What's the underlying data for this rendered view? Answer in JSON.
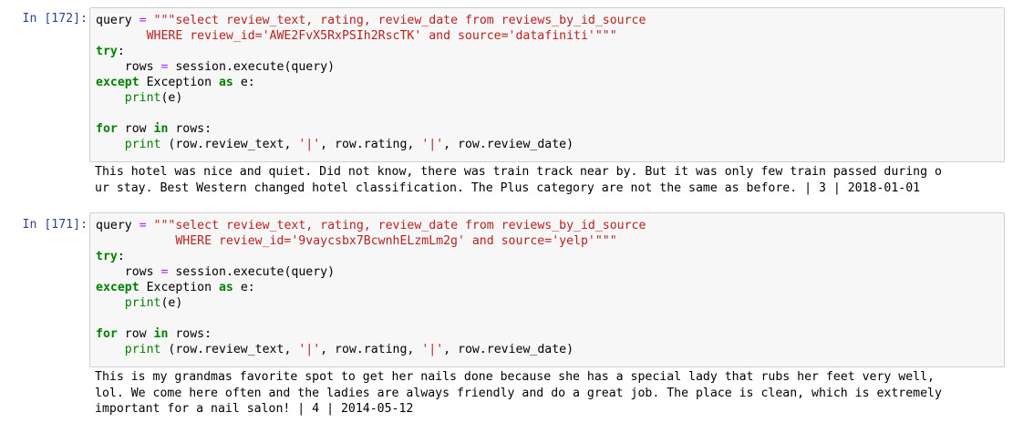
{
  "cells": [
    {
      "prompt": "In [172]:",
      "code": [
        [
          {
            "t": "query "
          },
          {
            "t": "=",
            "c": "op"
          },
          {
            "t": " "
          },
          {
            "t": "\"\"\"select review_text, rating, review_date from reviews_by_id_source",
            "c": "str"
          }
        ],
        [
          {
            "t": "       WHERE review_id='AWE2FvX5RxPSIh2RscTK' and source='datafiniti'\"\"\"",
            "c": "str"
          }
        ],
        [
          {
            "t": "try",
            "c": "kw"
          },
          {
            "t": ":"
          }
        ],
        [
          {
            "t": "    rows "
          },
          {
            "t": "=",
            "c": "op"
          },
          {
            "t": " session.execute(query)"
          }
        ],
        [
          {
            "t": "except",
            "c": "kw"
          },
          {
            "t": " Exception "
          },
          {
            "t": "as",
            "c": "kw"
          },
          {
            "t": " e:"
          }
        ],
        [
          {
            "t": "    "
          },
          {
            "t": "print",
            "c": "bi"
          },
          {
            "t": "(e)"
          }
        ],
        [
          {
            "t": ""
          }
        ],
        [
          {
            "t": "for",
            "c": "kw"
          },
          {
            "t": " row "
          },
          {
            "t": "in",
            "c": "kw"
          },
          {
            "t": " rows:"
          }
        ],
        [
          {
            "t": "    "
          },
          {
            "t": "print",
            "c": "bi"
          },
          {
            "t": " (row.review_text, "
          },
          {
            "t": "'|'",
            "c": "str"
          },
          {
            "t": ", row.rating, "
          },
          {
            "t": "'|'",
            "c": "str"
          },
          {
            "t": ", row.review_date)"
          }
        ]
      ],
      "output": [
        "This hotel was nice and quiet. Did not know, there was train track near by. But it was only few train passed during o",
        "ur stay. Best Western changed hotel classification. The Plus category are not the same as before. | 3 | 2018-01-01"
      ]
    },
    {
      "prompt": "In [171]:",
      "code": [
        [
          {
            "t": "query "
          },
          {
            "t": "=",
            "c": "op"
          },
          {
            "t": " "
          },
          {
            "t": "\"\"\"select review_text, rating, review_date from reviews_by_id_source",
            "c": "str"
          }
        ],
        [
          {
            "t": "           WHERE review_id='9vaycsbx7BcwnhELzmLm2g' and source='yelp'\"\"\"",
            "c": "str"
          }
        ],
        [
          {
            "t": "try",
            "c": "kw"
          },
          {
            "t": ":"
          }
        ],
        [
          {
            "t": "    rows "
          },
          {
            "t": "=",
            "c": "op"
          },
          {
            "t": " session.execute(query)"
          }
        ],
        [
          {
            "t": "except",
            "c": "kw"
          },
          {
            "t": " Exception "
          },
          {
            "t": "as",
            "c": "kw"
          },
          {
            "t": " e:"
          }
        ],
        [
          {
            "t": "    "
          },
          {
            "t": "print",
            "c": "bi"
          },
          {
            "t": "(e)"
          }
        ],
        [
          {
            "t": ""
          }
        ],
        [
          {
            "t": "for",
            "c": "kw"
          },
          {
            "t": " row "
          },
          {
            "t": "in",
            "c": "kw"
          },
          {
            "t": " rows:"
          }
        ],
        [
          {
            "t": "    "
          },
          {
            "t": "print",
            "c": "bi"
          },
          {
            "t": " (row.review_text, "
          },
          {
            "t": "'|'",
            "c": "str"
          },
          {
            "t": ", row.rating, "
          },
          {
            "t": "'|'",
            "c": "str"
          },
          {
            "t": ", row.review_date)"
          }
        ]
      ],
      "output": [
        "This is my grandmas favorite spot to get her nails done because she has a special lady that rubs her feet very well,",
        "lol. We come here often and the ladies are always friendly and do a great job. The place is clean, which is extremely",
        "important for a nail salon! | 4 | 2014-05-12"
      ]
    }
  ]
}
